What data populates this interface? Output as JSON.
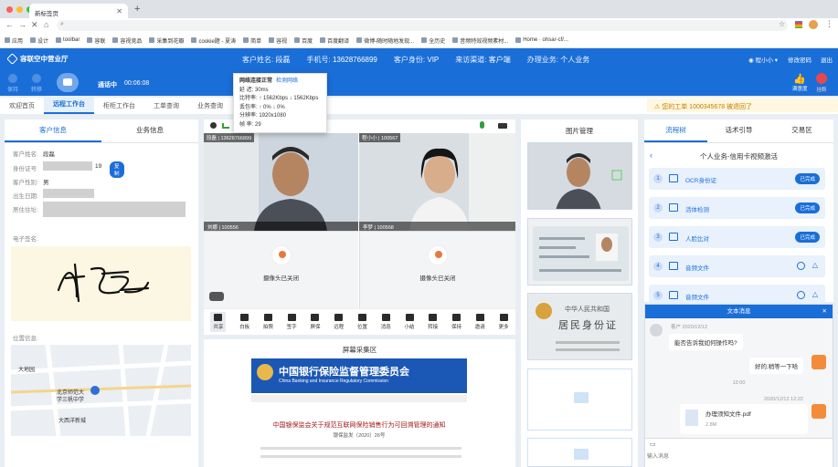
{
  "browser": {
    "tab_title": "新标签页",
    "tab_close": "✕",
    "new_tab": "+",
    "url": "",
    "bookmarks": [
      "应用",
      "设计",
      "toolbar",
      "容联",
      "容视竞品",
      "采集到花瓣",
      "cookie题 - 夏涛",
      "简单",
      "容视",
      "百度",
      "百度翻译",
      "微博-随时随地发现...",
      "全历史",
      "音频特效视频素材...",
      "Home · ohsar-cf/..."
    ]
  },
  "header": {
    "app_name": "容联空中营业厅",
    "customer_name_label": "客户姓名:",
    "customer_name": "段磊",
    "phone_label": "手机号:",
    "phone": "13628766899",
    "identity_label": "客户身份:",
    "identity": "VIP",
    "channel_label": "来访渠道:",
    "channel": "客户端",
    "business_label": "办理业务:",
    "business": "个人业务",
    "user": "程小小",
    "change_password": "修改密码",
    "logout": "退出"
  },
  "toolbar": {
    "hold_label": "保持",
    "transfer_label": "转移",
    "call_status": "通话中",
    "call_time": "00:06:08",
    "satisfaction_label": "满意度",
    "hangup_label": "挂断"
  },
  "subnav": {
    "tabs": [
      "欢迎首页",
      "远程工作台",
      "柜柜工作台",
      "工单查询",
      "业务查询"
    ],
    "active": 1,
    "warning": "您的工单 1000345678 被退回了"
  },
  "network_tooltip": {
    "title": "网络连接正常",
    "detect": "检测网络",
    "latency": "延  迟: 30ms",
    "bitrate": "比特率: ↑ 1562Kbps  ↓ 1562Kbps",
    "loss": "丢包率: ↑ 0%       ↓ 0%",
    "resolution": "分辨率: 1920x1080",
    "fps": "帧  率: 29"
  },
  "customer_panel": {
    "tabs": [
      "客户信息",
      "业务信息"
    ],
    "name_label": "客户姓名:",
    "name": "段磊",
    "id_label": "身份证号:",
    "id_tail": "19",
    "copy": "复制",
    "gender_label": "客户性别:",
    "gender": "男",
    "birth_label": "出生日期:",
    "address_label": "居住住址:",
    "sign_label": "电子签名:",
    "location_label": "位置信息:",
    "map_labels": [
      "大地园",
      "北京师范大",
      "学三帆中学",
      "大西洋新城"
    ]
  },
  "video": {
    "v1_top": "段磊 | 13628766899",
    "v2_top": "程小小 | 100567",
    "v1_label": "刘娜 | 100556",
    "v2_label": "李梦 | 100568",
    "cam_off": "摄像头已关闭"
  },
  "tools": [
    "共享",
    "白板",
    "拍照",
    "签字",
    "屏保",
    "远程",
    "位置",
    "消息",
    "小结",
    "转接",
    "保持",
    "邀请",
    "更多"
  ],
  "screen_capture": {
    "title": "屏幕采集区",
    "banner_cn": "中国银行保险监督管理委员会",
    "banner_en": "China Banking and Insurance Regulatory Commission",
    "doc_title": "中国银保监会关于规范互联网保险销售行为可回溯管理的通知",
    "doc_no": "银保监发〔2020〕26号"
  },
  "image_panel": {
    "title": "图片管理",
    "id_card_text": [
      "中华人民共和国",
      "居民身份证"
    ]
  },
  "process_panel": {
    "tabs": [
      "流程树",
      "话术引导",
      "交易区"
    ],
    "heading": "个人业务-信用卡视频激活",
    "items": [
      {
        "n": "1",
        "label": "OCR身份证",
        "status": "已完成"
      },
      {
        "n": "2",
        "label": "活体检测",
        "status": "已完成"
      },
      {
        "n": "3",
        "label": "人脸比对",
        "status": "已完成"
      },
      {
        "n": "4",
        "label": "音频文件",
        "status": ""
      },
      {
        "n": "5",
        "label": "音频文件",
        "status": ""
      }
    ]
  },
  "chat": {
    "title": "文本消息",
    "m1_meta": "客户  2020/12/12",
    "m1": "能否告诉我如何操作吗?",
    "m2": "好的,稍等一下哈",
    "time": "12:00",
    "m3_meta": "2020/12/12 12:22",
    "file_name": "办理须知文件.pdf",
    "file_size": "2.8M",
    "input_placeholder": "输入消息"
  }
}
